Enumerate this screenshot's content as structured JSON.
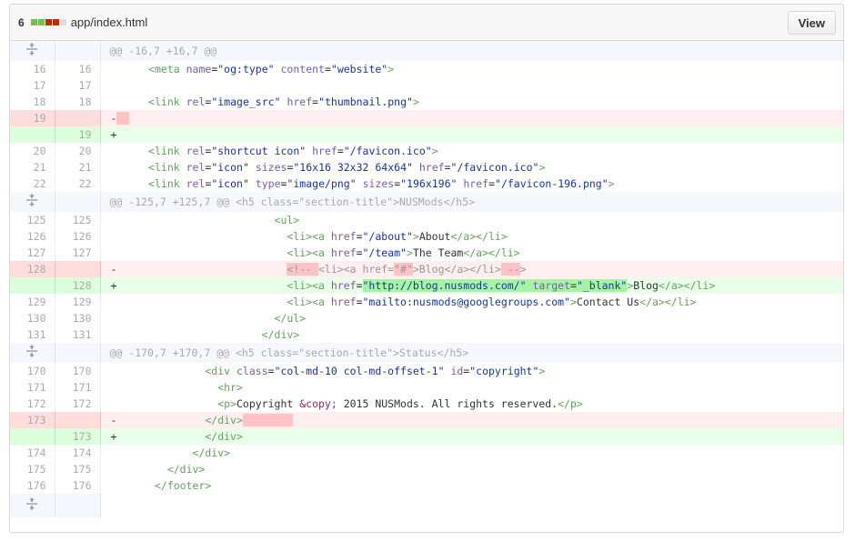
{
  "header": {
    "count": "6",
    "filename": "app/index.html",
    "view_label": "View"
  },
  "hunks": [
    "@@ -16,7 +16,7 @@",
    "@@ -125,7 +125,7 @@ <h5 class=\"section-title\">NUSMods</h5>",
    "@@ -170,7 +170,7 @@ <h5 class=\"section-title\">Status</h5>"
  ],
  "lines": [
    {
      "old": "16",
      "new": "16",
      "text": "<meta name=\"og:type\" content=\"website\">"
    },
    {
      "old": "17",
      "new": "17",
      "text": ""
    },
    {
      "old": "18",
      "new": "18",
      "text": "<link rel=\"image_src\" href=\"thumbnail.png\">"
    },
    {
      "old": "19",
      "new": "",
      "text": "-"
    },
    {
      "old": "",
      "new": "19",
      "text": "+"
    },
    {
      "old": "20",
      "new": "20",
      "text": "<link rel=\"shortcut icon\" href=\"/favicon.ico\">"
    },
    {
      "old": "21",
      "new": "21",
      "text": "<link rel=\"icon\" sizes=\"16x16 32x32 64x64\" href=\"/favicon.ico\">"
    },
    {
      "old": "22",
      "new": "22",
      "text": "<link rel=\"icon\" type=\"image/png\" sizes=\"196x196\" href=\"/favicon-196.png\">"
    },
    {
      "old": "125",
      "new": "125",
      "text": "<ul>"
    },
    {
      "old": "126",
      "new": "126",
      "text": "<li><a href=\"/about\">About</a></li>"
    },
    {
      "old": "127",
      "new": "127",
      "text": "<li><a href=\"/team\">The Team</a></li>"
    },
    {
      "old": "128",
      "new": "",
      "text": "<!-- <li><a href=\"#\">Blog</a></li> -->"
    },
    {
      "old": "",
      "new": "128",
      "text": "<li><a href=\"http://blog.nusmods.com/\" target=\"_blank\">Blog</a></li>"
    },
    {
      "old": "129",
      "new": "129",
      "text": "<li><a href=\"mailto:nusmods@googlegroups.com\">Contact Us</a></li>"
    },
    {
      "old": "130",
      "new": "130",
      "text": "</ul>"
    },
    {
      "old": "131",
      "new": "131",
      "text": "</div>"
    },
    {
      "old": "170",
      "new": "170",
      "text": "<div class=\"col-md-10 col-md-offset-1\" id=\"copyright\">"
    },
    {
      "old": "171",
      "new": "171",
      "text": "<hr>"
    },
    {
      "old": "172",
      "new": "172",
      "text": "<p>Copyright &copy; 2015 NUSMods. All rights reserved.</p>"
    },
    {
      "old": "173",
      "new": "",
      "text": "</div>"
    },
    {
      "old": "",
      "new": "173",
      "text": "</div>"
    },
    {
      "old": "174",
      "new": "174",
      "text": "</div>"
    },
    {
      "old": "175",
      "new": "175",
      "text": "</div>"
    },
    {
      "old": "176",
      "new": "176",
      "text": "</footer>"
    }
  ],
  "colors": {
    "added": "#6cc644",
    "deleted": "#bd2c00",
    "neutral": "#dddddd"
  },
  "icons": {
    "expand": "unfold-icon"
  }
}
